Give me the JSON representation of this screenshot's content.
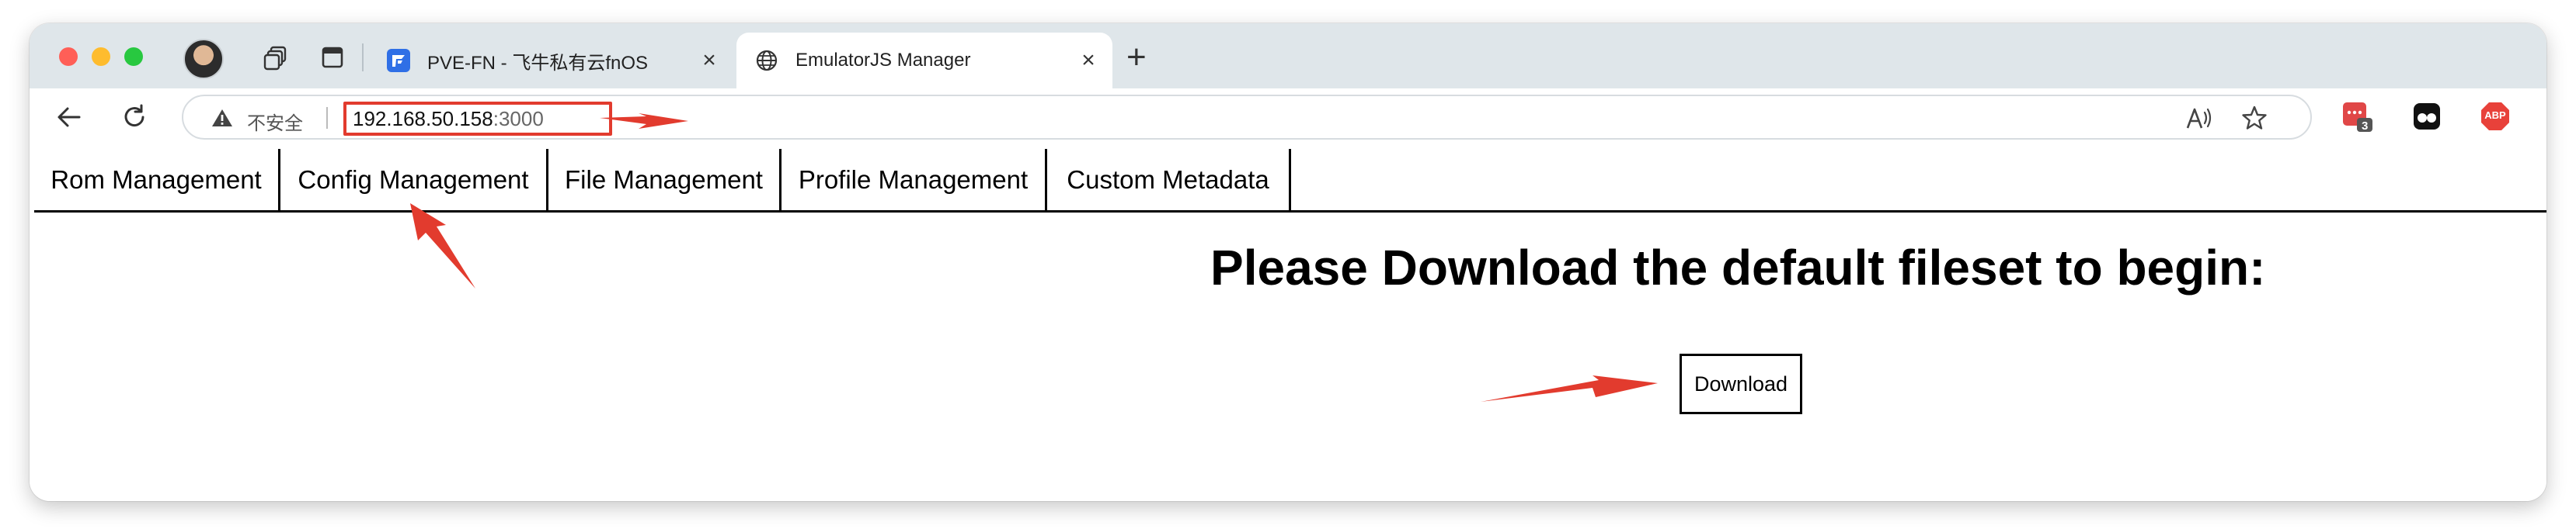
{
  "browser": {
    "tabs": [
      {
        "title": "PVE-FN - 飞牛私有云fnOS",
        "favicon": "fnos-logo-icon",
        "active": false
      },
      {
        "title": "EmulatorJS Manager",
        "favicon": "globe-icon",
        "active": true
      }
    ],
    "close_glyph": "×",
    "new_tab_glyph": "+",
    "security_label": "不安全",
    "url_host": "192.168.50.158",
    "url_port": ":3000",
    "extension_badge": "3",
    "abp_label": "ABP"
  },
  "page": {
    "nav": [
      "Rom Management",
      "Config Management",
      "File Management",
      "Profile Management",
      "Custom Metadata"
    ],
    "heading": "Please Download the default fileset to begin:",
    "download_label": "Download"
  },
  "colors": {
    "annotation_red": "#e23b2e",
    "tabstrip": "#dfe6ea"
  }
}
